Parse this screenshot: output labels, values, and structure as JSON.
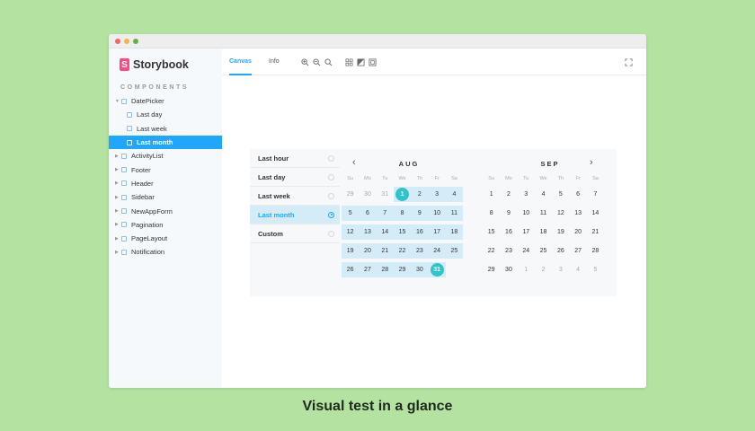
{
  "app": {
    "brand": "Storybook",
    "section_label": "COMPONENTS"
  },
  "sidebar": {
    "items": [
      {
        "label": "DatePicker",
        "level": 0,
        "expanded": true
      },
      {
        "label": "Last day",
        "level": 1
      },
      {
        "label": "Last week",
        "level": 1
      },
      {
        "label": "Last month",
        "level": 1,
        "selected": true
      },
      {
        "label": "ActivityList",
        "level": 0
      },
      {
        "label": "Footer",
        "level": 0
      },
      {
        "label": "Header",
        "level": 0
      },
      {
        "label": "Sidebar",
        "level": 0
      },
      {
        "label": "NewAppForm",
        "level": 0
      },
      {
        "label": "Pagination",
        "level": 0
      },
      {
        "label": "PageLayout",
        "level": 0
      },
      {
        "label": "Notification",
        "level": 0
      }
    ]
  },
  "toolbar": {
    "tabs": [
      {
        "label": "Canvas",
        "active": true
      },
      {
        "label": "Info",
        "active": false
      }
    ],
    "icons": [
      "zoom-in-icon",
      "zoom-out-icon",
      "zoom-reset-icon",
      "grid-icon",
      "background-icon",
      "outline-icon",
      "fullscreen-icon"
    ]
  },
  "datepicker": {
    "presets": [
      {
        "label": "Last hour"
      },
      {
        "label": "Last day"
      },
      {
        "label": "Last week"
      },
      {
        "label": "Last month",
        "selected": true
      },
      {
        "label": "Custom"
      }
    ],
    "weekdays": [
      "Su",
      "Mo",
      "Tu",
      "We",
      "Th",
      "Fr",
      "Sa"
    ],
    "months": [
      {
        "title": "AUG",
        "weeks": [
          [
            {
              "d": "29",
              "out": true
            },
            {
              "d": "30",
              "out": true
            },
            {
              "d": "31",
              "out": true
            },
            {
              "d": "1",
              "range": true,
              "edge": true
            },
            {
              "d": "2",
              "range": true
            },
            {
              "d": "3",
              "range": true
            },
            {
              "d": "4",
              "range": true
            }
          ],
          [
            {
              "d": "5",
              "range": true
            },
            {
              "d": "6",
              "range": true
            },
            {
              "d": "7",
              "range": true
            },
            {
              "d": "8",
              "range": true
            },
            {
              "d": "9",
              "range": true
            },
            {
              "d": "10",
              "range": true
            },
            {
              "d": "11",
              "range": true
            }
          ],
          [
            {
              "d": "12",
              "range": true
            },
            {
              "d": "13",
              "range": true
            },
            {
              "d": "14",
              "range": true
            },
            {
              "d": "15",
              "range": true
            },
            {
              "d": "16",
              "range": true
            },
            {
              "d": "17",
              "range": true
            },
            {
              "d": "18",
              "range": true
            }
          ],
          [
            {
              "d": "19",
              "range": true
            },
            {
              "d": "20",
              "range": true
            },
            {
              "d": "21",
              "range": true
            },
            {
              "d": "22",
              "range": true
            },
            {
              "d": "23",
              "range": true
            },
            {
              "d": "24",
              "range": true
            },
            {
              "d": "25",
              "range": true
            }
          ],
          [
            {
              "d": "26",
              "range": true
            },
            {
              "d": "27",
              "range": true
            },
            {
              "d": "28",
              "range": true
            },
            {
              "d": "29",
              "range": true
            },
            {
              "d": "30",
              "range": true
            },
            {
              "d": "31",
              "range": true,
              "edge": true
            },
            {
              "d": ""
            }
          ]
        ]
      },
      {
        "title": "SEP",
        "weeks": [
          [
            {
              "d": "1"
            },
            {
              "d": "2"
            },
            {
              "d": "3"
            },
            {
              "d": "4"
            },
            {
              "d": "5"
            },
            {
              "d": "6"
            },
            {
              "d": "7"
            }
          ],
          [
            {
              "d": "8"
            },
            {
              "d": "9"
            },
            {
              "d": "10"
            },
            {
              "d": "11"
            },
            {
              "d": "12"
            },
            {
              "d": "13"
            },
            {
              "d": "14"
            }
          ],
          [
            {
              "d": "15"
            },
            {
              "d": "16"
            },
            {
              "d": "17"
            },
            {
              "d": "18"
            },
            {
              "d": "19"
            },
            {
              "d": "20"
            },
            {
              "d": "21"
            }
          ],
          [
            {
              "d": "22"
            },
            {
              "d": "23"
            },
            {
              "d": "24"
            },
            {
              "d": "25"
            },
            {
              "d": "26"
            },
            {
              "d": "27"
            },
            {
              "d": "28"
            }
          ],
          [
            {
              "d": "29"
            },
            {
              "d": "30"
            },
            {
              "d": "1",
              "out": true
            },
            {
              "d": "2",
              "out": true
            },
            {
              "d": "3",
              "out": true
            },
            {
              "d": "4",
              "out": true
            },
            {
              "d": "5",
              "out": true
            }
          ]
        ]
      }
    ]
  },
  "caption": "Visual test in a glance",
  "colors": {
    "background": "#b4e2a1",
    "accent": "#1ea7fd",
    "range": "#d4ecf7",
    "selected_day": "#2fc4cc",
    "brand": "#ff4785"
  }
}
